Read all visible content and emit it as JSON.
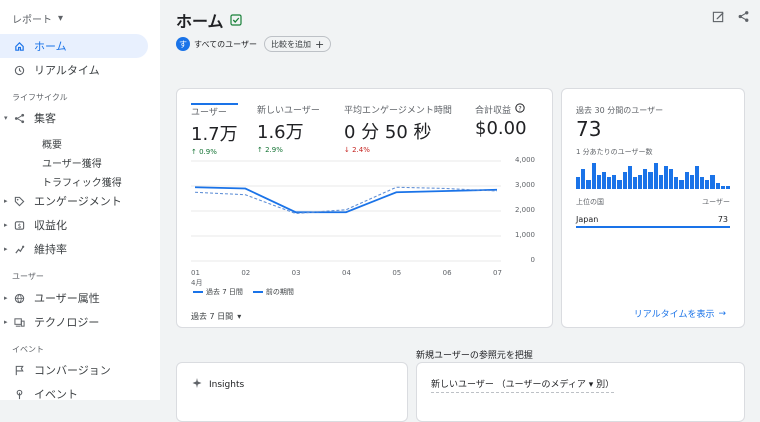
{
  "sidebar": {
    "report_label": "レポート",
    "items": {
      "home": "ホーム",
      "realtime": "リアルタイム",
      "lifecycle_heading": "ライフサイクル",
      "acquisition": "集客",
      "acq_overview": "概要",
      "acq_user": "ユーザー獲得",
      "acq_traffic": "トラフィック獲得",
      "engagement": "エンゲージメント",
      "monetization": "収益化",
      "retention": "維持率",
      "user_heading": "ユーザー",
      "user_attributes": "ユーザー属性",
      "technology": "テクノロジー",
      "event_heading": "イベント",
      "conversions": "コンバージョン",
      "events": "イベント"
    }
  },
  "header": {
    "title": "ホーム"
  },
  "chips": {
    "all_users": "すべてのユーザー",
    "all_users_avatar": "す",
    "add_comparison": "比較を追加"
  },
  "metrics": [
    {
      "label": "ユーザー",
      "value": "1.7万",
      "delta": "↑ 0.9%"
    },
    {
      "label": "新しいユーザー",
      "value": "1.6万",
      "delta": "↑ 2.9%"
    },
    {
      "label": "平均エンゲージメント時間",
      "value": "0 分 50 秒",
      "delta": "↓ 2.4%"
    },
    {
      "label": "合計収益",
      "value": "$0.00"
    }
  ],
  "chart_data": {
    "type": "line",
    "x": [
      "01",
      "02",
      "03",
      "04",
      "05",
      "06",
      "07"
    ],
    "x_sub": "4月",
    "ylim": [
      0,
      4000
    ],
    "yticks": [
      "4,000",
      "3,000",
      "2,000",
      "1,000",
      "0"
    ],
    "series": [
      {
        "name": "過去 7 日間",
        "values": [
          2950,
          2900,
          1950,
          1950,
          2750,
          2800,
          2850
        ],
        "style": "solid"
      },
      {
        "name": "前の期間",
        "values": [
          2750,
          2650,
          1900,
          2050,
          2950,
          2900,
          2800
        ],
        "style": "dashed"
      }
    ],
    "colors": {
      "primary": "#1a73e8",
      "grid": "#e0e0e0"
    }
  },
  "period_selector": "過去 7 日間",
  "realtime": {
    "label": "過去 30 分間のユーザー",
    "value": "73",
    "sub_label": "1 分あたりのユーザー数",
    "bars": [
      4,
      7,
      3,
      9,
      5,
      6,
      4,
      5,
      3,
      6,
      8,
      4,
      5,
      7,
      6,
      9,
      5,
      8,
      7,
      4,
      3,
      6,
      5,
      8,
      4,
      3,
      5,
      2,
      1,
      1
    ],
    "col_country": "上位の国",
    "col_users": "ユーザー",
    "row_country": "Japan",
    "row_users": "73",
    "link": "リアルタイムを表示"
  },
  "bottom": {
    "section_label": "新規ユーザーの参照元を把握",
    "insights_label": "Insights",
    "card_title": "新しいユーザー （ユーザーのメディア ▾ 別）"
  }
}
